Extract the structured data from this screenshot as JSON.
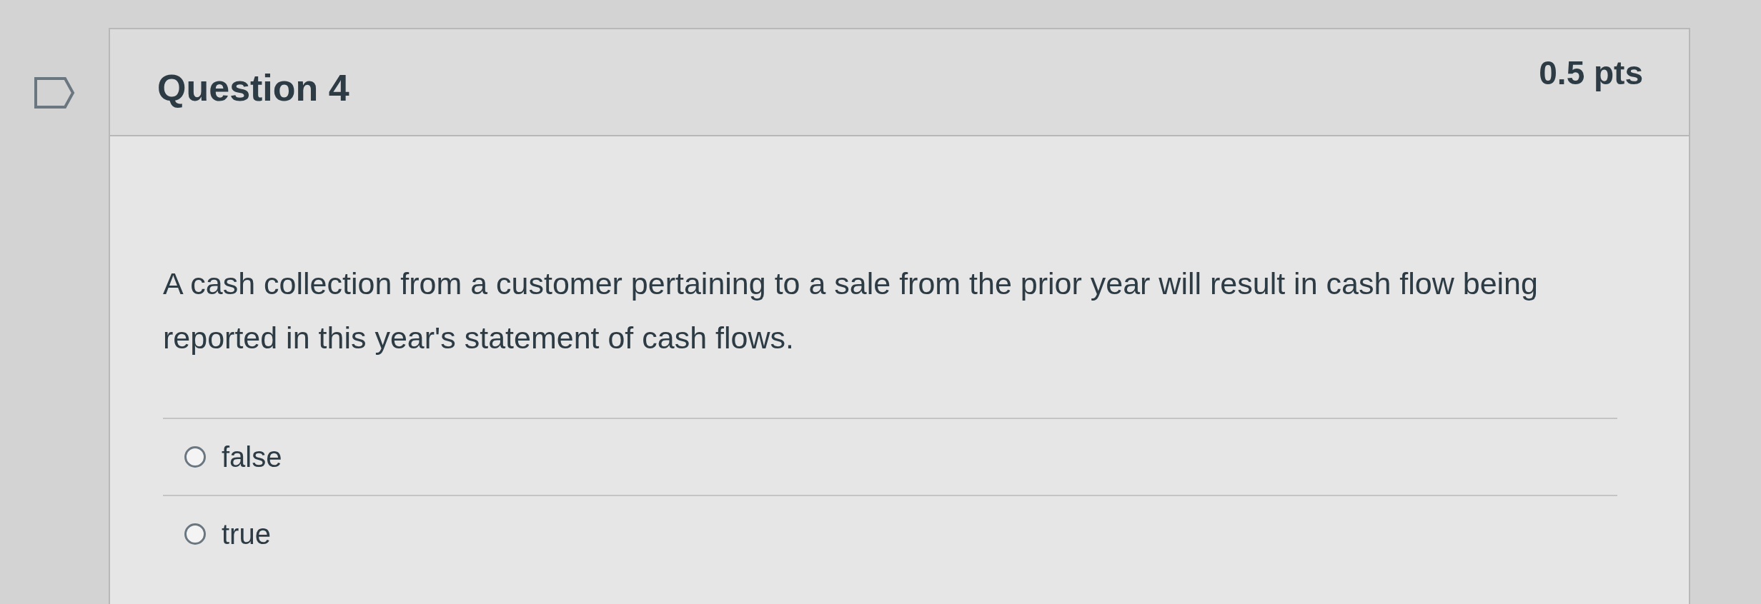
{
  "question": {
    "title": "Question 4",
    "points": "0.5 pts",
    "flagged": false,
    "text": "A cash collection from a customer pertaining to a sale from the prior year will result in cash flow being reported in this year's statement of cash flows.",
    "answers": [
      {
        "label": "false",
        "selected": false
      },
      {
        "label": "true",
        "selected": false
      }
    ]
  }
}
